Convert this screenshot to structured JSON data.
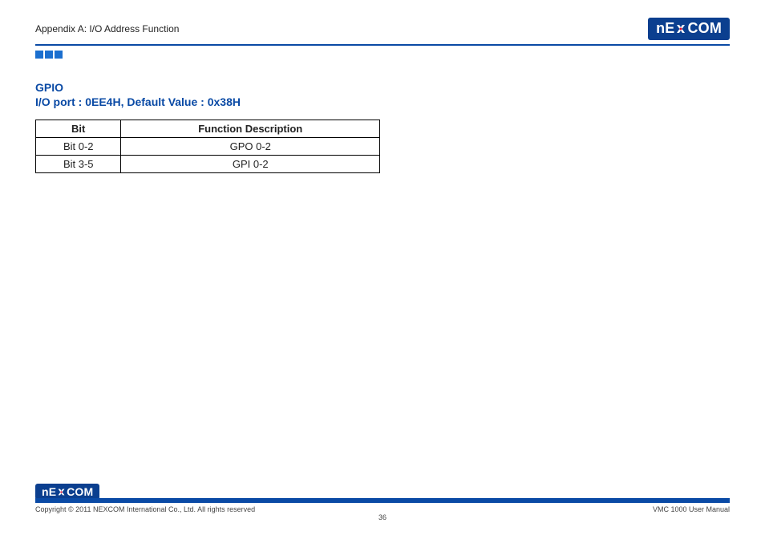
{
  "header": {
    "breadcrumb": "Appendix A: I/O Address Function",
    "logo_pre": "nE",
    "logo_post": "COM"
  },
  "gpio": {
    "title": "GPIO",
    "port_line": "I/O port : 0EE4H, Default Value : 0x38H",
    "table": {
      "head_bit": "Bit",
      "head_desc": "Function Description",
      "rows": [
        {
          "bit": "Bit 0-2",
          "desc": "GPO 0-2"
        },
        {
          "bit": "Bit 3-5",
          "desc": "GPI 0-2"
        }
      ]
    }
  },
  "footer": {
    "copyright": "Copyright © 2011 NEXCOM International Co., Ltd. All rights reserved",
    "page_no": "36",
    "manual": "VMC 1000 User Manual"
  }
}
